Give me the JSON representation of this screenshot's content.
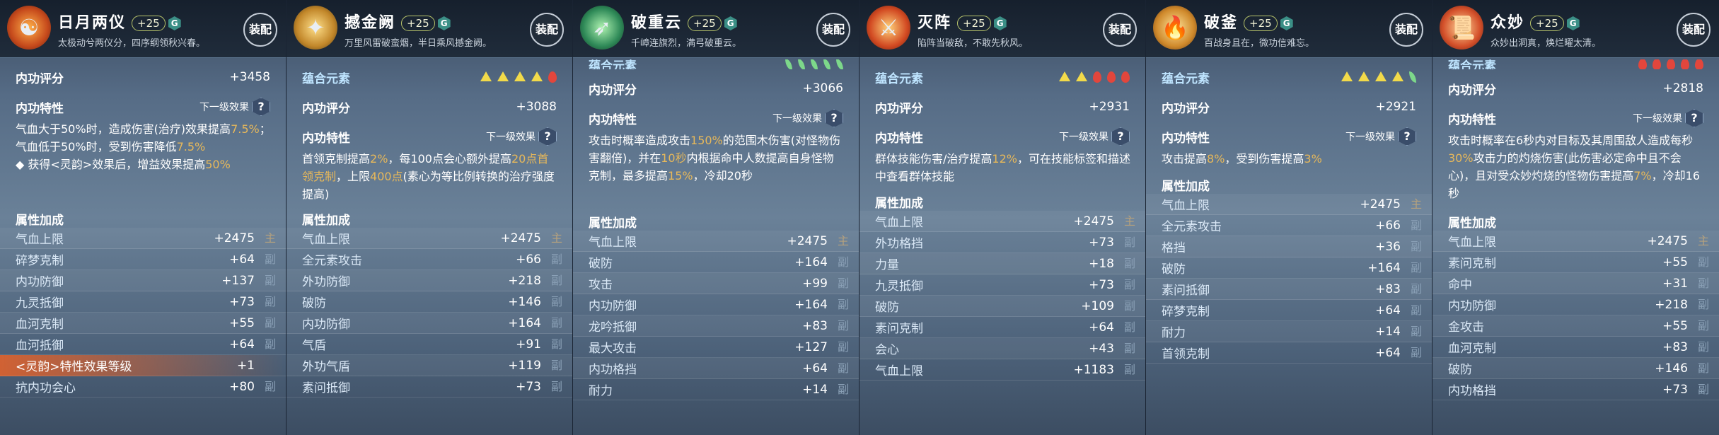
{
  "panels": [
    {
      "name": "日月两仪",
      "level": "+25",
      "grade": "G",
      "subtitle": "太极动兮两仪分，四序纲领秋兴春。",
      "equip_label": "装配",
      "score_label": "内功评分",
      "score": "+3458",
      "trait_label": "内功特性",
      "next_label": "下一级效果",
      "desc_html": "气血大于50%时，造成伤害(治疗)效果提高<span class='hl'>7.5%</span>；气血低于50%时，受到伤害降低<span class='hl'>7.5%</span><br>◆ 获得&lt;灵韵&gt;效果后，增益效果提高<span class='hl'>50%</span>",
      "attr_title": "属性加成",
      "attrs": [
        {
          "name": "气血上限",
          "value": "+2475",
          "tag": "主"
        },
        {
          "name": "碎梦克制",
          "value": "+64",
          "tag": "副"
        },
        {
          "name": "内功防御",
          "value": "+137",
          "tag": "副"
        },
        {
          "name": "九灵抵御",
          "value": "+73",
          "tag": "副"
        },
        {
          "name": "血河克制",
          "value": "+55",
          "tag": "副"
        },
        {
          "name": "血河抵御",
          "value": "+64",
          "tag": "副"
        },
        {
          "name": "<灵韵>特性效果等级",
          "value": "+1",
          "tag": "",
          "glow": true
        },
        {
          "name": "抗内功会心",
          "value": "+80",
          "tag": "副"
        }
      ]
    },
    {
      "name": "撼金阙",
      "level": "+25",
      "grade": "G",
      "subtitle": "万里风雷破蛮烟，半日乘风撼金阙。",
      "equip_label": "装配",
      "yuan_label": "蕴合元素",
      "score_label": "内功评分",
      "score": "+3088",
      "trait_label": "内功特性",
      "next_label": "下一级效果",
      "desc_html": "首领克制提高<span class='hl'>2%</span>，每100点会心额外提高<span class='hl'>20点首领克制</span>，上限<span class='hl'>400点</span>(素心为等比例转换的治疗强度提高)",
      "attr_title": "属性加成",
      "attrs": [
        {
          "name": "气血上限",
          "value": "+2475",
          "tag": "主"
        },
        {
          "name": "全元素攻击",
          "value": "+66",
          "tag": "副"
        },
        {
          "name": "外功防御",
          "value": "+218",
          "tag": "副"
        },
        {
          "name": "破防",
          "value": "+146",
          "tag": "副"
        },
        {
          "name": "内功防御",
          "value": "+164",
          "tag": "副"
        },
        {
          "name": "气盾",
          "value": "+91",
          "tag": "副"
        },
        {
          "name": "外功气盾",
          "value": "+119",
          "tag": "副"
        },
        {
          "name": "素问抵御",
          "value": "+73",
          "tag": "副"
        }
      ]
    },
    {
      "name": "破重云",
      "level": "+25",
      "grade": "G",
      "subtitle": "千嶂连旗烈，满弓破重云。",
      "equip_label": "装配",
      "yuan_label": "蕴合元素",
      "score_label": "内功评分",
      "score": "+3066",
      "trait_label": "内功特性",
      "next_label": "下一级效果",
      "desc_html": "攻击时概率造成攻击<span class='hl'>150%</span>的范围木伤害(对怪物伤害翻倍)，并在<span class='hl'>10秒</span>内根据命中人数提高自身怪物克制，最多提高<span class='hl'>15%</span>，冷却20秒",
      "attr_title": "属性加成",
      "attrs": [
        {
          "name": "气血上限",
          "value": "+2475",
          "tag": "主"
        },
        {
          "name": "破防",
          "value": "+164",
          "tag": "副"
        },
        {
          "name": "攻击",
          "value": "+99",
          "tag": "副"
        },
        {
          "name": "内功防御",
          "value": "+164",
          "tag": "副"
        },
        {
          "name": "龙吟抵御",
          "value": "+83",
          "tag": "副"
        },
        {
          "name": "最大攻击",
          "value": "+127",
          "tag": "副"
        },
        {
          "name": "内功格挡",
          "value": "+64",
          "tag": "副"
        },
        {
          "name": "耐力",
          "value": "+14",
          "tag": "副"
        }
      ]
    },
    {
      "name": "灭阵",
      "level": "+25",
      "grade": "G",
      "subtitle": "陷阵当破敌，不敢先秋风。",
      "equip_label": "装配",
      "yuan_label": "蕴合元素",
      "score_label": "内功评分",
      "score": "+2931",
      "trait_label": "内功特性",
      "next_label": "下一级效果",
      "desc_html": "群体技能伤害/治疗提高<span class='hl'>12%</span>，可在技能标签和描述中查看群体技能",
      "attr_title": "属性加成",
      "attrs": [
        {
          "name": "气血上限",
          "value": "+2475",
          "tag": "主"
        },
        {
          "name": "外功格挡",
          "value": "+73",
          "tag": "副"
        },
        {
          "name": "力量",
          "value": "+18",
          "tag": "副"
        },
        {
          "name": "九灵抵御",
          "value": "+73",
          "tag": "副"
        },
        {
          "name": "破防",
          "value": "+109",
          "tag": "副"
        },
        {
          "name": "素问克制",
          "value": "+64",
          "tag": "副"
        },
        {
          "name": "会心",
          "value": "+43",
          "tag": "副"
        },
        {
          "name": "气血上限",
          "value": "+1183",
          "tag": "副"
        }
      ]
    },
    {
      "name": "破釜",
      "level": "+25",
      "grade": "G",
      "subtitle": "百战身且在，微功信难忘。",
      "equip_label": "装配",
      "yuan_label": "蕴合元素",
      "score_label": "内功评分",
      "score": "+2921",
      "trait_label": "内功特性",
      "next_label": "下一级效果",
      "desc_html": "攻击提高<span class='hl'>8%</span>，受到伤害提高<span class='hl'>3%</span>",
      "attr_title": "属性加成",
      "attrs": [
        {
          "name": "气血上限",
          "value": "+2475",
          "tag": "主"
        },
        {
          "name": "全元素攻击",
          "value": "+66",
          "tag": "副"
        },
        {
          "name": "格挡",
          "value": "+36",
          "tag": "副"
        },
        {
          "name": "破防",
          "value": "+164",
          "tag": "副"
        },
        {
          "name": "素问抵御",
          "value": "+83",
          "tag": "副"
        },
        {
          "name": "碎梦克制",
          "value": "+64",
          "tag": "副"
        },
        {
          "name": "耐力",
          "value": "+14",
          "tag": "副"
        },
        {
          "name": "首领克制",
          "value": "+64",
          "tag": "副"
        }
      ]
    },
    {
      "name": "众妙",
      "level": "+25",
      "grade": "G",
      "subtitle": "众妙出洞真，焕烂曜太清。",
      "equip_label": "装配",
      "yuan_label": "蕴合元素",
      "score_label": "内功评分",
      "score": "+2818",
      "trait_label": "内功特性",
      "next_label": "下一级效果",
      "desc_html": "攻击时概率在6秒内对目标及其周围敌人造成每秒<span class='hl'>30%</span>攻击力的灼烧伤害(此伤害必定命中且不会心)，且对受众妙灼烧的怪物伤害提高<span class='hl'>7%</span>，冷却16秒",
      "attr_title": "属性加成",
      "attrs": [
        {
          "name": "气血上限",
          "value": "+2475",
          "tag": "主"
        },
        {
          "name": "素问克制",
          "value": "+55",
          "tag": "副"
        },
        {
          "name": "命中",
          "value": "+31",
          "tag": "副"
        },
        {
          "name": "内功防御",
          "value": "+218",
          "tag": "副"
        },
        {
          "name": "金攻击",
          "value": "+55",
          "tag": "副"
        },
        {
          "name": "血河克制",
          "value": "+83",
          "tag": "副"
        },
        {
          "name": "破防",
          "value": "+146",
          "tag": "副"
        },
        {
          "name": "内功格挡",
          "value": "+73",
          "tag": "副"
        }
      ]
    }
  ],
  "colors": {
    "highlight": "#e7b85a",
    "main_tag": "#b7a27d"
  }
}
